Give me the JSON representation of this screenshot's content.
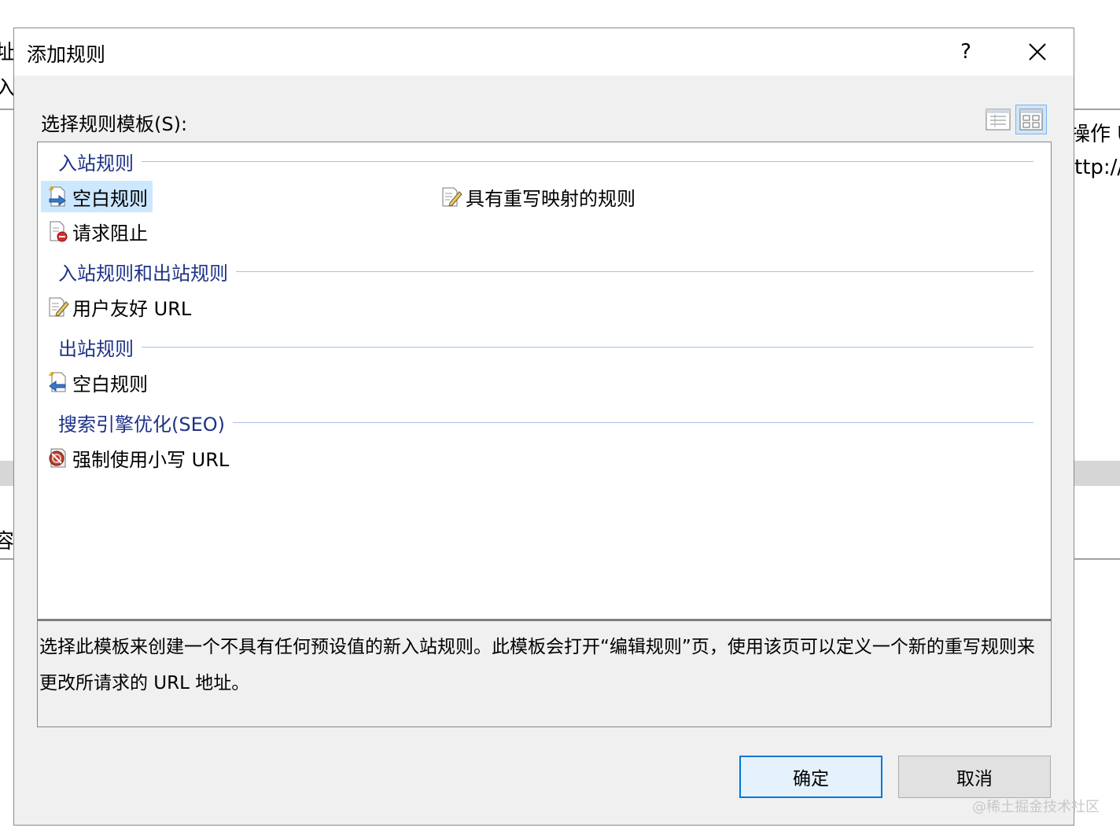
{
  "background": {
    "fragments": [
      "址",
      "入",
      "操作 U",
      "ttp://",
      "容"
    ]
  },
  "dialog": {
    "title": "添加规则",
    "help_label": "?",
    "select_label": "选择规则模板(S):",
    "groups": [
      {
        "title": "入站规则",
        "items": [
          {
            "label": "空白规则",
            "icon": "blank-inbound-rule-icon",
            "selected": true
          },
          {
            "label": "具有重写映射的规则",
            "icon": "rewrite-map-rule-icon",
            "selected": false
          },
          {
            "label": "请求阻止",
            "icon": "request-blocking-icon",
            "selected": false
          }
        ]
      },
      {
        "title": "入站规则和出站规则",
        "items": [
          {
            "label": "用户友好 URL",
            "icon": "user-friendly-url-icon",
            "selected": false
          }
        ]
      },
      {
        "title": "出站规则",
        "items": [
          {
            "label": "空白规则",
            "icon": "blank-outbound-rule-icon",
            "selected": false
          }
        ]
      },
      {
        "title": "搜索引擎优化(SEO)",
        "items": [
          {
            "label": "强制使用小写 URL",
            "icon": "lowercase-url-icon",
            "selected": false
          }
        ]
      }
    ],
    "description": "选择此模板来创建一个不具有任何预设值的新入站规则。此模板会打开“编辑规则”页，使用该页可以定义一个新的重写规则来更改所请求的 URL 地址。",
    "ok_label": "确定",
    "cancel_label": "取消"
  },
  "watermark": "@稀土掘金技术社区",
  "colors": {
    "group_title": "#1e3287",
    "group_line": "#a7c1e6",
    "selection": "#cce8ff",
    "ok_border": "#0078d7",
    "dialog_bg": "#f0f0f0"
  }
}
